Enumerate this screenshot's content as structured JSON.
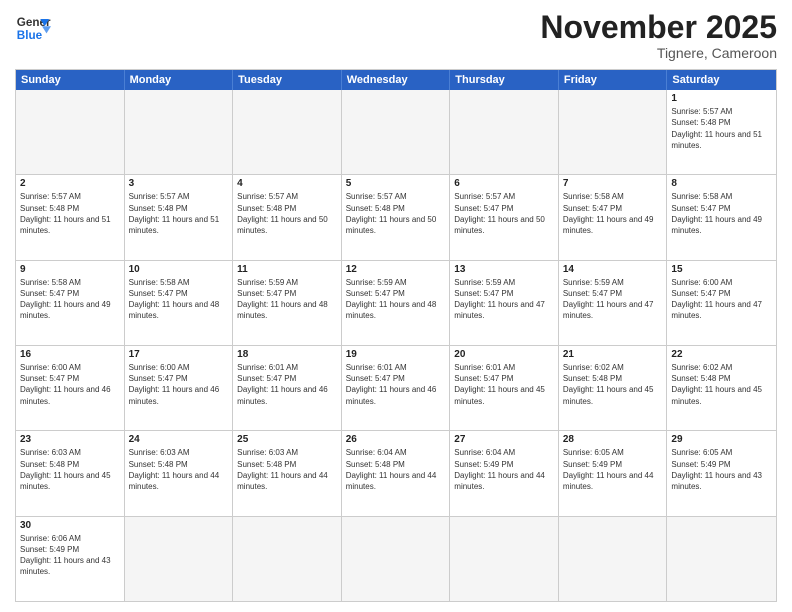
{
  "header": {
    "logo_general": "General",
    "logo_blue": "Blue",
    "month_year": "November 2025",
    "location": "Tignere, Cameroon"
  },
  "weekdays": [
    "Sunday",
    "Monday",
    "Tuesday",
    "Wednesday",
    "Thursday",
    "Friday",
    "Saturday"
  ],
  "rows": [
    [
      {
        "day": "",
        "empty": true
      },
      {
        "day": "",
        "empty": true
      },
      {
        "day": "",
        "empty": true
      },
      {
        "day": "",
        "empty": true
      },
      {
        "day": "",
        "empty": true
      },
      {
        "day": "",
        "empty": true
      },
      {
        "day": "1",
        "sunrise": "5:57 AM",
        "sunset": "5:48 PM",
        "daylight": "11 hours and 51 minutes."
      }
    ],
    [
      {
        "day": "2",
        "sunrise": "5:57 AM",
        "sunset": "5:48 PM",
        "daylight": "11 hours and 51 minutes."
      },
      {
        "day": "3",
        "sunrise": "5:57 AM",
        "sunset": "5:48 PM",
        "daylight": "11 hours and 51 minutes."
      },
      {
        "day": "4",
        "sunrise": "5:57 AM",
        "sunset": "5:48 PM",
        "daylight": "11 hours and 50 minutes."
      },
      {
        "day": "5",
        "sunrise": "5:57 AM",
        "sunset": "5:48 PM",
        "daylight": "11 hours and 50 minutes."
      },
      {
        "day": "6",
        "sunrise": "5:57 AM",
        "sunset": "5:47 PM",
        "daylight": "11 hours and 50 minutes."
      },
      {
        "day": "7",
        "sunrise": "5:58 AM",
        "sunset": "5:47 PM",
        "daylight": "11 hours and 49 minutes."
      },
      {
        "day": "8",
        "sunrise": "5:58 AM",
        "sunset": "5:47 PM",
        "daylight": "11 hours and 49 minutes."
      }
    ],
    [
      {
        "day": "9",
        "sunrise": "5:58 AM",
        "sunset": "5:47 PM",
        "daylight": "11 hours and 49 minutes."
      },
      {
        "day": "10",
        "sunrise": "5:58 AM",
        "sunset": "5:47 PM",
        "daylight": "11 hours and 48 minutes."
      },
      {
        "day": "11",
        "sunrise": "5:59 AM",
        "sunset": "5:47 PM",
        "daylight": "11 hours and 48 minutes."
      },
      {
        "day": "12",
        "sunrise": "5:59 AM",
        "sunset": "5:47 PM",
        "daylight": "11 hours and 48 minutes."
      },
      {
        "day": "13",
        "sunrise": "5:59 AM",
        "sunset": "5:47 PM",
        "daylight": "11 hours and 47 minutes."
      },
      {
        "day": "14",
        "sunrise": "5:59 AM",
        "sunset": "5:47 PM",
        "daylight": "11 hours and 47 minutes."
      },
      {
        "day": "15",
        "sunrise": "6:00 AM",
        "sunset": "5:47 PM",
        "daylight": "11 hours and 47 minutes."
      }
    ],
    [
      {
        "day": "16",
        "sunrise": "6:00 AM",
        "sunset": "5:47 PM",
        "daylight": "11 hours and 46 minutes."
      },
      {
        "day": "17",
        "sunrise": "6:00 AM",
        "sunset": "5:47 PM",
        "daylight": "11 hours and 46 minutes."
      },
      {
        "day": "18",
        "sunrise": "6:01 AM",
        "sunset": "5:47 PM",
        "daylight": "11 hours and 46 minutes."
      },
      {
        "day": "19",
        "sunrise": "6:01 AM",
        "sunset": "5:47 PM",
        "daylight": "11 hours and 46 minutes."
      },
      {
        "day": "20",
        "sunrise": "6:01 AM",
        "sunset": "5:47 PM",
        "daylight": "11 hours and 45 minutes."
      },
      {
        "day": "21",
        "sunrise": "6:02 AM",
        "sunset": "5:48 PM",
        "daylight": "11 hours and 45 minutes."
      },
      {
        "day": "22",
        "sunrise": "6:02 AM",
        "sunset": "5:48 PM",
        "daylight": "11 hours and 45 minutes."
      }
    ],
    [
      {
        "day": "23",
        "sunrise": "6:03 AM",
        "sunset": "5:48 PM",
        "daylight": "11 hours and 45 minutes."
      },
      {
        "day": "24",
        "sunrise": "6:03 AM",
        "sunset": "5:48 PM",
        "daylight": "11 hours and 44 minutes."
      },
      {
        "day": "25",
        "sunrise": "6:03 AM",
        "sunset": "5:48 PM",
        "daylight": "11 hours and 44 minutes."
      },
      {
        "day": "26",
        "sunrise": "6:04 AM",
        "sunset": "5:48 PM",
        "daylight": "11 hours and 44 minutes."
      },
      {
        "day": "27",
        "sunrise": "6:04 AM",
        "sunset": "5:49 PM",
        "daylight": "11 hours and 44 minutes."
      },
      {
        "day": "28",
        "sunrise": "6:05 AM",
        "sunset": "5:49 PM",
        "daylight": "11 hours and 44 minutes."
      },
      {
        "day": "29",
        "sunrise": "6:05 AM",
        "sunset": "5:49 PM",
        "daylight": "11 hours and 43 minutes."
      }
    ],
    [
      {
        "day": "30",
        "sunrise": "6:06 AM",
        "sunset": "5:49 PM",
        "daylight": "11 hours and 43 minutes."
      },
      {
        "day": "",
        "empty": true
      },
      {
        "day": "",
        "empty": true
      },
      {
        "day": "",
        "empty": true
      },
      {
        "day": "",
        "empty": true
      },
      {
        "day": "",
        "empty": true
      },
      {
        "day": "",
        "empty": true
      }
    ]
  ]
}
